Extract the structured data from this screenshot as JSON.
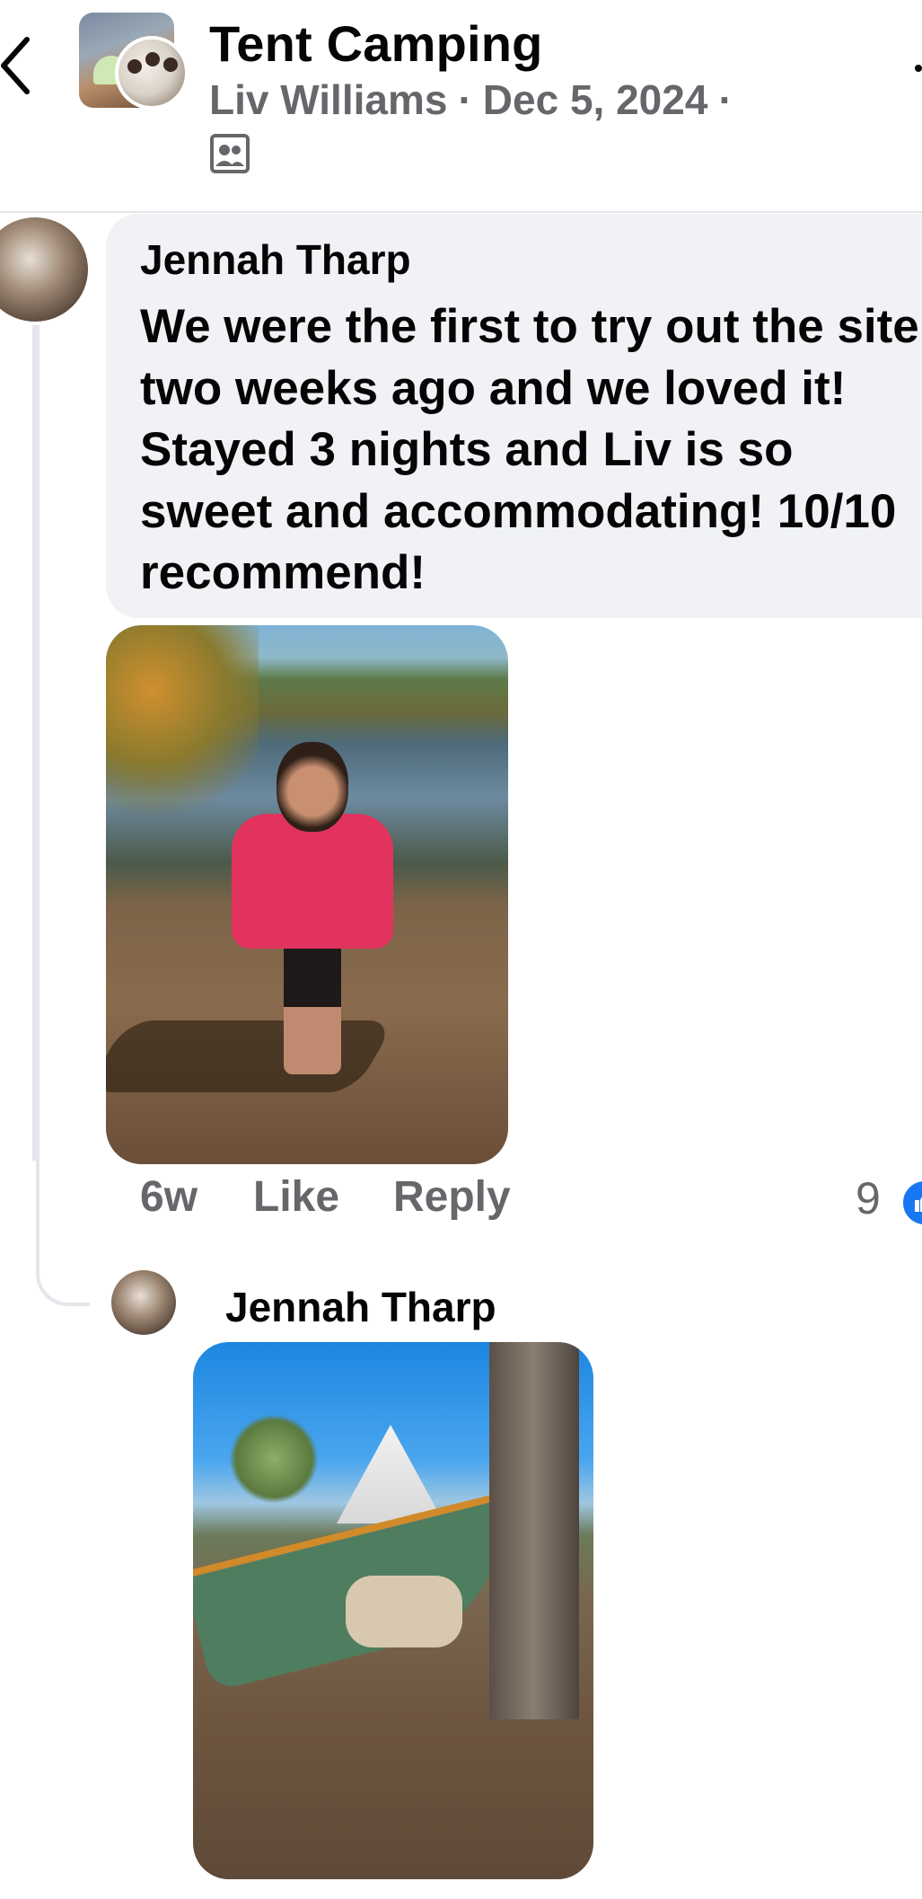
{
  "header": {
    "title": "Tent Camping",
    "author": "Liv Williams",
    "date": "Dec 5, 2024",
    "separator": "·",
    "audience_icon": "group-members-icon"
  },
  "comment": {
    "author": "Jennah Tharp",
    "text": "We were the first to try out the site two weeks ago and we loved it! Stayed 3 nights and Liv is so sweet and accommodating! 10/10 recommend!",
    "time": "6w",
    "like_label": "Like",
    "reply_label": "Reply",
    "reaction_count": "9",
    "reaction_icon": "like-icon"
  },
  "reply": {
    "author": "Jennah Tharp"
  },
  "colors": {
    "text_primary": "#050505",
    "text_secondary": "#65676b",
    "bubble": "#f0f2f5",
    "like_blue": "#1877f2"
  }
}
